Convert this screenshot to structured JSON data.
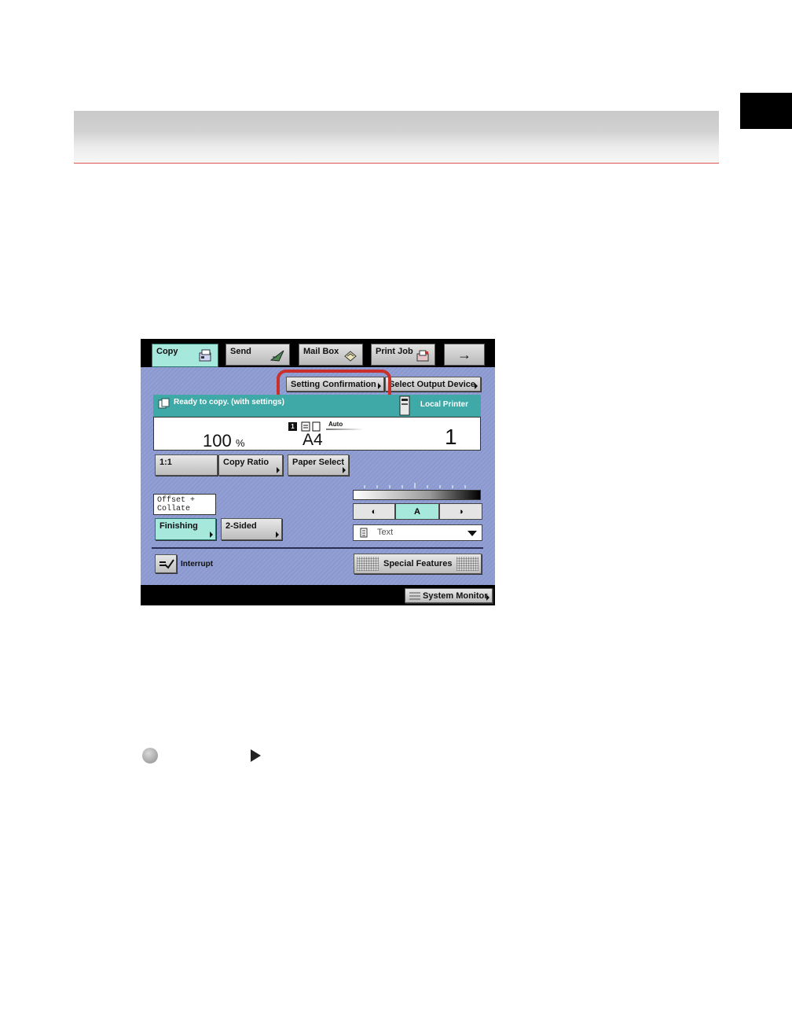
{
  "tabs": {
    "copy": "Copy",
    "send": "Send",
    "mail_box": "Mail Box",
    "print_job": "Print Job",
    "next": "→"
  },
  "top_buttons": {
    "setting_confirmation": "Setting Confirmation",
    "select_output_device": "Select Output Device"
  },
  "status": {
    "message": "Ready to copy. (with settings)",
    "printer": "Local Printer"
  },
  "info": {
    "ratio_value": "100",
    "ratio_unit": "%",
    "paper_mode": "Auto",
    "paper_size": "A4",
    "copies": "1",
    "mode_number": "1"
  },
  "buttons": {
    "one_to_one": "1:1",
    "copy_ratio": "Copy Ratio",
    "paper_select": "Paper Select",
    "finishing": "Finishing",
    "two_sided": "2-Sided",
    "interrupt": "Interrupt",
    "special_features": "Special Features",
    "system_monitor": "System Monitor"
  },
  "finishing_tooltip": {
    "line1": "Offset +",
    "line2": "Collate"
  },
  "density": {
    "light": "◐",
    "auto": "A",
    "dark": "◑"
  },
  "original_type": {
    "selected": "Text"
  },
  "colors": {
    "panel_bg": "#8a98cf",
    "active_tab": "#a6e8dc",
    "status_bar": "#3ea9a6",
    "highlight": "#c9302c"
  }
}
